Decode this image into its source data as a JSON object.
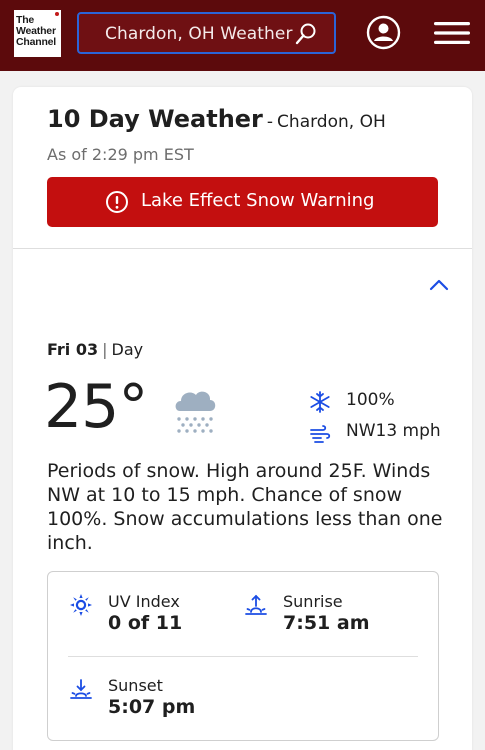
{
  "header": {
    "logo_lines": [
      "The",
      "Weather",
      "Channel"
    ],
    "search_text": "Chardon, OH Weather",
    "icons": {
      "search": "search-icon",
      "account": "account-icon",
      "menu": "hamburger-menu-icon"
    },
    "colors": {
      "bar": "#5c0a0c",
      "search_bg": "#6f1013",
      "search_border": "#2b64d8"
    }
  },
  "page": {
    "title": "10 Day Weather",
    "title_separator": "-",
    "location": "Chardon, OH",
    "as_of": "As of 2:29 pm EST"
  },
  "alert": {
    "label": "Lake Effect Snow Warning",
    "icon": "alert-circle-icon",
    "color": "#c30f0f"
  },
  "day": {
    "date": "Fri 03",
    "separator": "|",
    "period": "Day",
    "temperature": "25°",
    "condition_icon": "snow-cloud-icon",
    "precip_chance": "100%",
    "wind": "NW13 mph",
    "description": "Periods of snow. High around 25F. Winds NW at 10 to 15 mph. Chance of snow 100%. Snow accumulations less than one inch.",
    "details": {
      "uv": {
        "label": "UV Index",
        "value": "0 of 11",
        "icon": "uv-sun-icon"
      },
      "sunrise": {
        "label": "Sunrise",
        "value": "7:51 am",
        "icon": "sunrise-icon"
      },
      "sunset": {
        "label": "Sunset",
        "value": "5:07 pm",
        "icon": "sunset-icon"
      }
    },
    "accent_color": "#1b4de4"
  }
}
